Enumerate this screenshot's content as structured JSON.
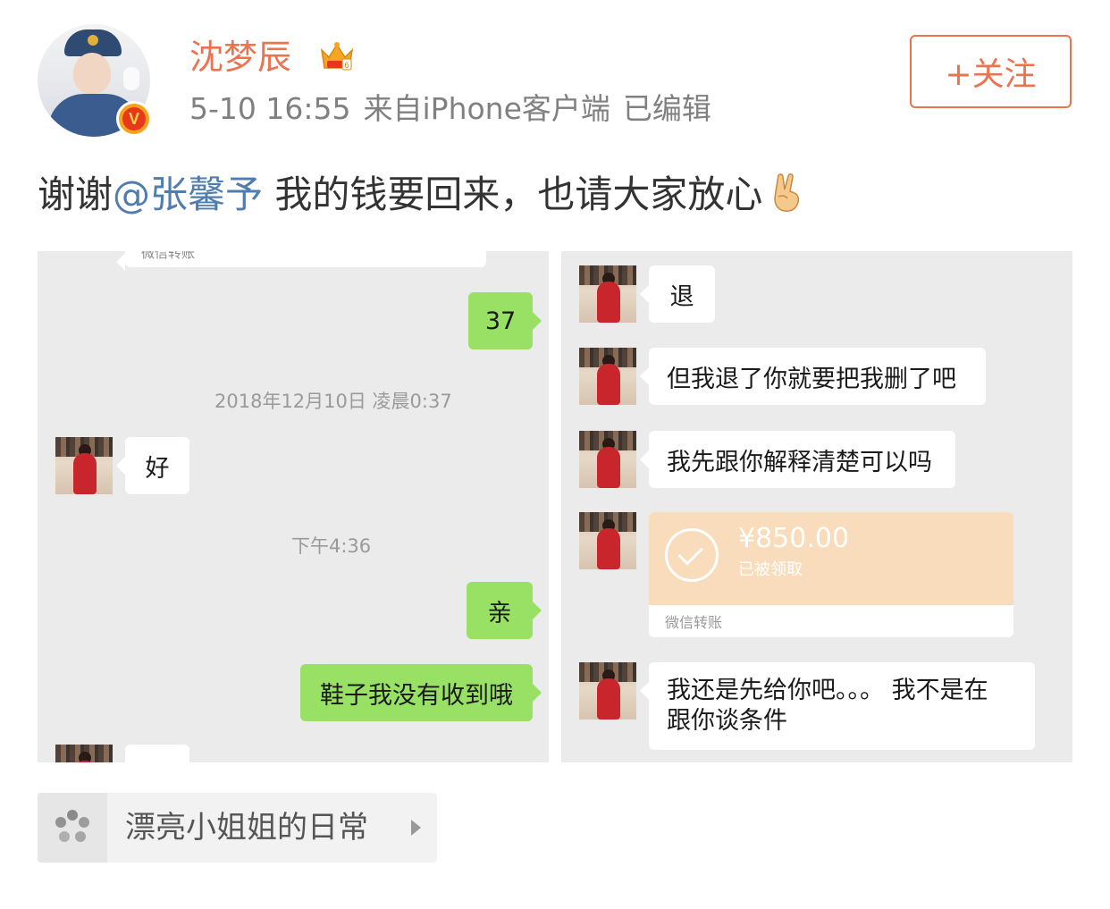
{
  "user": {
    "name": "沈梦辰",
    "time": "5-10 16:55",
    "source": "来自iPhone客户端",
    "edited": "已编辑",
    "verified_badge": "V",
    "follow_label": "+关注"
  },
  "post": {
    "text_before": "谢谢",
    "mention": "@张馨予",
    "text_after": " 我的钱要回来，也请大家放心",
    "emoji": "victory-hand"
  },
  "chat_left": {
    "partial_top": "微信转账",
    "messages": [
      {
        "side": "out",
        "text": "37"
      },
      {
        "side": "time",
        "text": "2018年12月10日 凌晨0:37"
      },
      {
        "side": "in",
        "text": "好"
      },
      {
        "side": "time",
        "text": "下午4:36"
      },
      {
        "side": "out",
        "text": "亲"
      },
      {
        "side": "out",
        "text": "鞋子我没有收到哦"
      }
    ]
  },
  "chat_right": {
    "messages": [
      {
        "side": "in",
        "text": "退"
      },
      {
        "side": "in",
        "text": "但我退了你就要把我删了吧"
      },
      {
        "side": "in",
        "text": "我先跟你解释清楚可以吗"
      },
      {
        "side": "in",
        "text": "我还是先给你吧。。。 我不是在"
      },
      {
        "side": "in",
        "text": "跟你谈条件"
      }
    ],
    "transfer": {
      "amount": "¥850.00",
      "status": "已被领取",
      "label": "微信转账"
    }
  },
  "topic": {
    "label": "漂亮小姐姐的日常",
    "icon": "topic-icon"
  },
  "colors": {
    "accent": "#eb7350",
    "mention": "#507daf",
    "wechat_green": "#98e165",
    "chat_bg": "#ebebeb"
  }
}
